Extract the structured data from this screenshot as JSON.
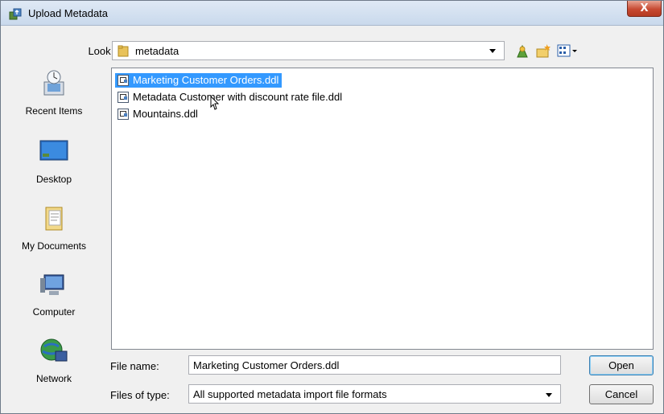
{
  "window": {
    "title": "Upload Metadata",
    "close_label": "X"
  },
  "lookin": {
    "label": "Look in:",
    "value": "metadata"
  },
  "toolbar": {
    "icons": [
      "up-folder-icon",
      "new-folder-icon",
      "view-menu-icon"
    ]
  },
  "places": [
    {
      "label": "Recent Items",
      "icon": "recent-items-icon"
    },
    {
      "label": "Desktop",
      "icon": "desktop-icon"
    },
    {
      "label": "My Documents",
      "icon": "my-documents-icon"
    },
    {
      "label": "Computer",
      "icon": "computer-icon"
    },
    {
      "label": "Network",
      "icon": "network-icon"
    }
  ],
  "files": [
    {
      "name": "Marketing Customer Orders.ddl",
      "selected": true
    },
    {
      "name": "Metadata Customer with discount rate file.ddl",
      "selected": false
    },
    {
      "name": "Mountains.ddl",
      "selected": false
    }
  ],
  "filename": {
    "label": "File name:",
    "value": "Marketing Customer Orders.ddl"
  },
  "filetype": {
    "label": "Files of type:",
    "value": "All supported metadata import file formats"
  },
  "buttons": {
    "open": "Open",
    "cancel": "Cancel"
  },
  "colors": {
    "selection": "#3399ff",
    "titlebar": "#c9d9ec",
    "close": "#c74a32"
  }
}
